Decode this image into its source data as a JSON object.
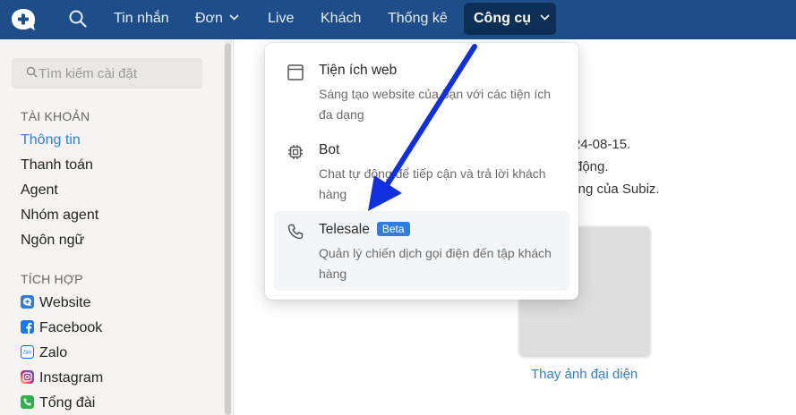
{
  "topnav": {
    "logo_icon": "chat-plus-icon",
    "search_icon": "search-icon",
    "items": [
      {
        "label": "Tin nhắn"
      },
      {
        "label": "Đơn"
      },
      {
        "label": "Live"
      },
      {
        "label": "Khách"
      },
      {
        "label": "Thống kê"
      }
    ],
    "active_label": "Công cụ"
  },
  "sidebar": {
    "search_placeholder": "Tìm kiếm cài đặt",
    "section_account": "TÀI KHOẢN",
    "account_items": [
      "Thông tin",
      "Thanh toán",
      "Agent",
      "Nhóm agent",
      "Ngôn ngữ"
    ],
    "section_integration": "TÍCH HỢP",
    "integration_items": [
      {
        "label": "Website",
        "icon": "website-icon",
        "color": "#2f7de1"
      },
      {
        "label": "Facebook",
        "icon": "facebook-icon",
        "color": "#1877f2"
      },
      {
        "label": "Zalo",
        "icon": "zalo-icon",
        "color": "#0068ff"
      },
      {
        "label": "Instagram",
        "icon": "instagram-icon",
        "color": "#d62976"
      },
      {
        "label": "Tổng đài",
        "icon": "phone-icon",
        "color": "#2bb24c"
      }
    ]
  },
  "main": {
    "line1": "24-08-15.",
    "line2": "động.",
    "line3": "năng của Subiz.",
    "avatar_link": "Thay ảnh đại diện"
  },
  "dropdown": {
    "items": [
      {
        "title": "Tiện ích web",
        "desc": "Sáng tạo website của bạn với các tiện ích đa dạng",
        "icon": "browser-window-icon"
      },
      {
        "title": "Bot",
        "desc": "Chat tự động để tiếp cận và trả lời khách hàng",
        "icon": "chip-icon"
      },
      {
        "title": "Telesale",
        "badge": "Beta",
        "desc": "Quản lý chiến dịch gọi điện đến tập khách hàng",
        "icon": "phone-icon"
      }
    ]
  },
  "colors": {
    "topbar": "#1d4e8a",
    "accent": "#2f7de1",
    "arrow": "#1030e0"
  }
}
